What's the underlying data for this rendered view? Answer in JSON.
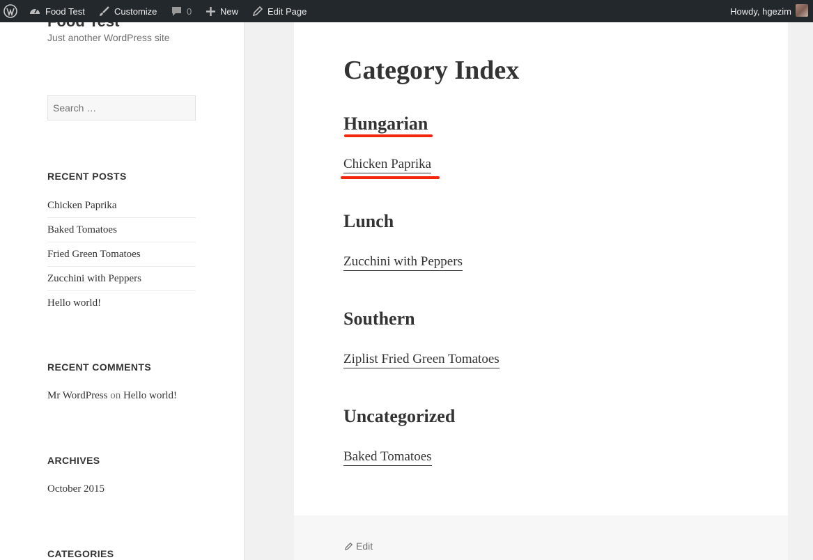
{
  "adminbar": {
    "site_name": "Food Test",
    "customize": "Customize",
    "comments_count": "0",
    "new_label": "New",
    "edit_page": "Edit Page",
    "howdy": "Howdy, hgezim"
  },
  "sidebar": {
    "site_title": "Food Test",
    "tagline": "Just another WordPress site",
    "search_placeholder": "Search …",
    "recent_posts": {
      "title": "RECENT POSTS",
      "items": [
        "Chicken Paprika",
        "Baked Tomatoes",
        "Fried Green Tomatoes",
        "Zucchini with Peppers",
        "Hello world!"
      ]
    },
    "recent_comments": {
      "title": "RECENT COMMENTS",
      "author": "Mr WordPress",
      "on": "on",
      "post": "Hello world!"
    },
    "archives": {
      "title": "ARCHIVES",
      "items": [
        "October 2015"
      ]
    },
    "categories": {
      "title": "CATEGORIES"
    }
  },
  "main": {
    "title": "Category Index",
    "categories": [
      {
        "name": "Hungarian",
        "posts": [
          "Chicken Paprika"
        ]
      },
      {
        "name": "Lunch",
        "posts": [
          "Zucchini with Peppers"
        ]
      },
      {
        "name": "Southern",
        "posts": [
          "Ziplist Fried Green Tomatoes"
        ]
      },
      {
        "name": "Uncategorized",
        "posts": [
          "Baked Tomatoes"
        ]
      }
    ],
    "edit_label": "Edit"
  },
  "annotation_color": "#f2270c"
}
